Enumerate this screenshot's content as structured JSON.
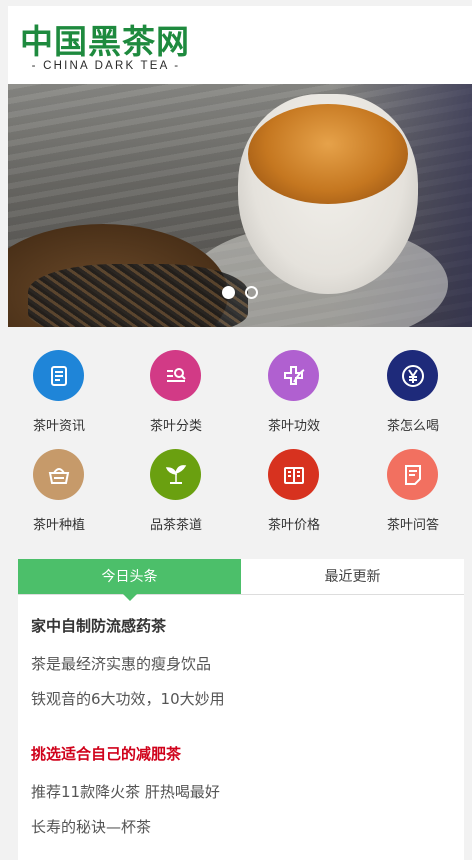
{
  "header": {
    "logo_cn": "中国黑茶网",
    "logo_en": "- CHINA DARK TEA -"
  },
  "banner": {
    "slides": 2,
    "active_slide": 1
  },
  "grid": [
    {
      "label": "茶叶资讯",
      "icon": "document-icon",
      "color": "#1f85d8"
    },
    {
      "label": "茶叶分类",
      "icon": "search-list-icon",
      "color": "#d23a86"
    },
    {
      "label": "茶叶功效",
      "icon": "leaf-plus-icon",
      "color": "#b060d0"
    },
    {
      "label": "茶怎么喝",
      "icon": "yen-icon",
      "color": "#1e2a7a"
    },
    {
      "label": "茶叶种植",
      "icon": "basket-icon",
      "color": "#c69a6a"
    },
    {
      "label": "品茶茶道",
      "icon": "sprout-icon",
      "color": "#6aa010"
    },
    {
      "label": "茶叶价格",
      "icon": "price-book-icon",
      "color": "#d7321f"
    },
    {
      "label": "茶叶问答",
      "icon": "notepad-icon",
      "color": "#f27060"
    }
  ],
  "news": {
    "tabs": [
      "今日头条",
      "最近更新"
    ],
    "active_tab": 0,
    "headline1": "家中自制防流感药茶",
    "items1": [
      "茶是最经济实惠的瘦身饮品",
      "铁观音的6大功效，10大妙用"
    ],
    "headline2": "挑选适合自己的减肥茶",
    "items2": [
      "推荐11款降火茶 肝热喝最好",
      "长寿的秘诀—杯茶"
    ],
    "headline2_color": "#d0021b"
  }
}
